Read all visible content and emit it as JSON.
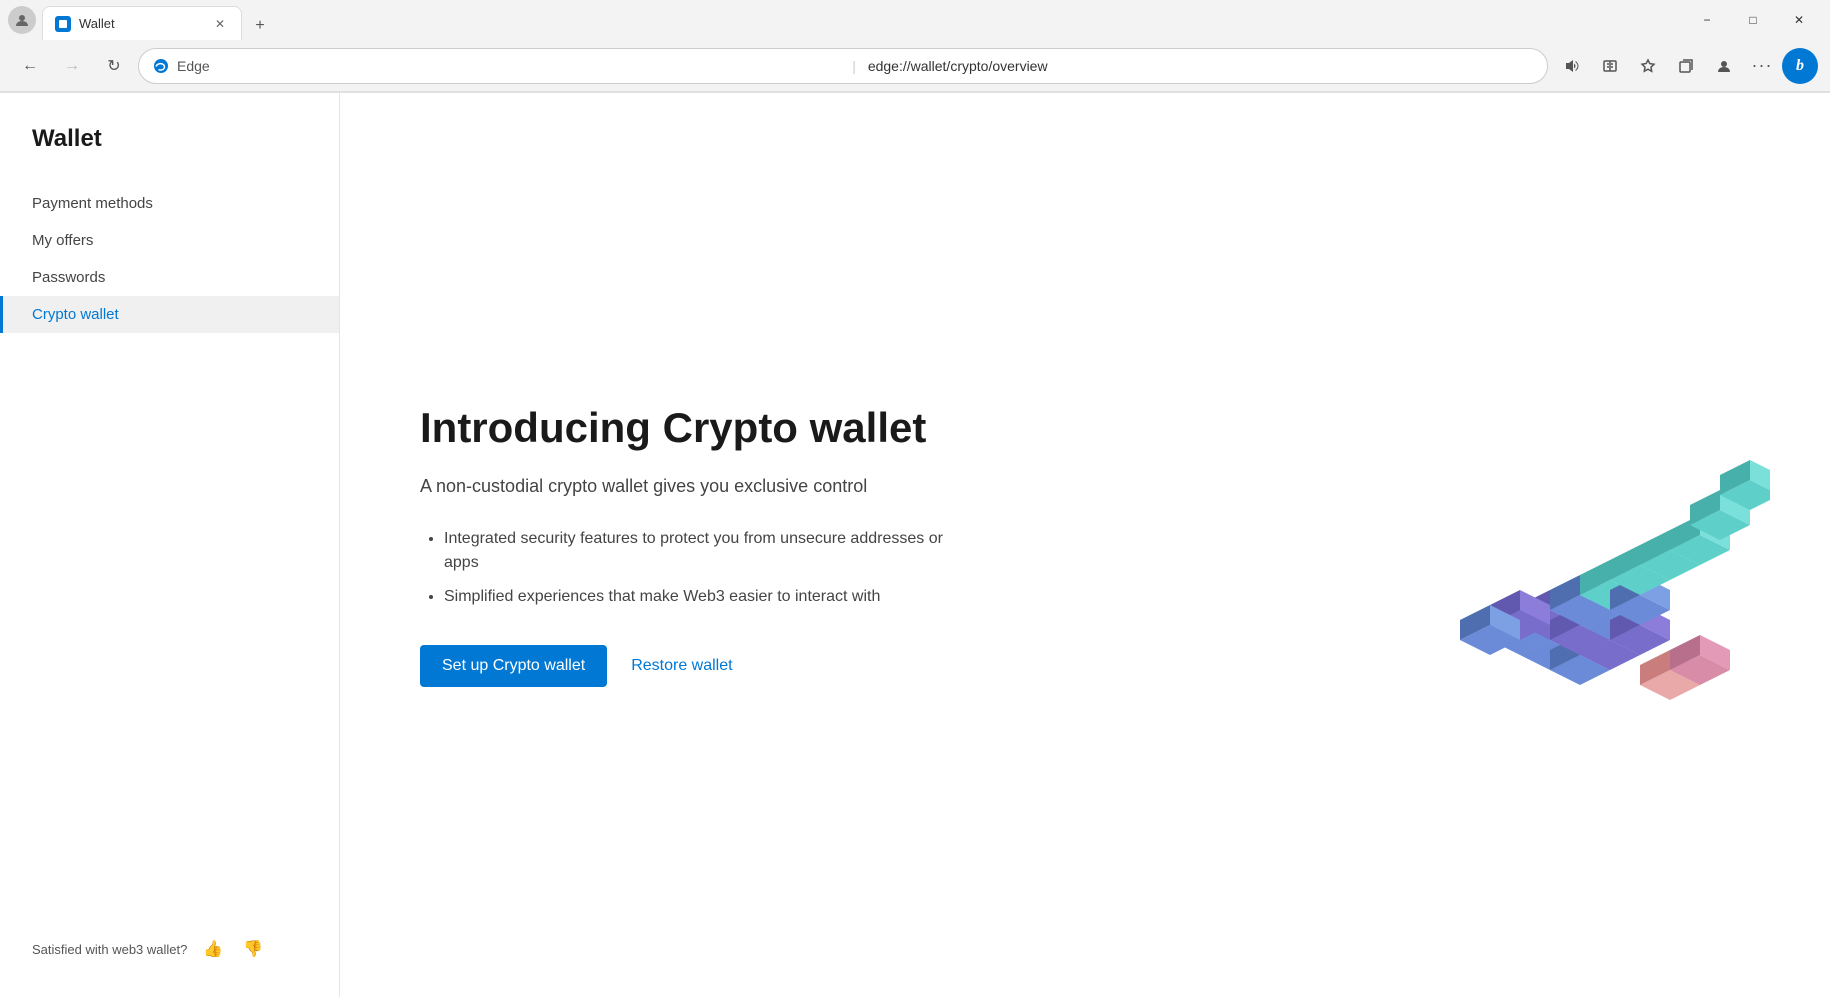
{
  "browser": {
    "tab": {
      "title": "Wallet",
      "favicon_label": "wallet-favicon"
    },
    "address_bar": {
      "edge_label": "Edge",
      "url": "edge://wallet/crypto/overview"
    },
    "window_controls": {
      "minimize": "−",
      "maximize": "□",
      "close": "✕"
    }
  },
  "sidebar": {
    "title": "Wallet",
    "nav_items": [
      {
        "id": "payment-methods",
        "label": "Payment methods",
        "active": false
      },
      {
        "id": "my-offers",
        "label": "My offers",
        "active": false
      },
      {
        "id": "passwords",
        "label": "Passwords",
        "active": false
      },
      {
        "id": "crypto-wallet",
        "label": "Crypto wallet",
        "active": true
      }
    ],
    "feedback": {
      "text": "Satisfied with web3 wallet?",
      "thumbs_up": "👍",
      "thumbs_down": "👎"
    }
  },
  "main": {
    "heading": "Introducing Crypto wallet",
    "subheading": "A non-custodial crypto wallet gives you exclusive control",
    "features": [
      "Integrated security features to protect you from unsecure addresses or apps",
      "Simplified experiences that make Web3 easier to interact with"
    ],
    "setup_button": "Set up Crypto wallet",
    "restore_button": "Restore wallet"
  }
}
